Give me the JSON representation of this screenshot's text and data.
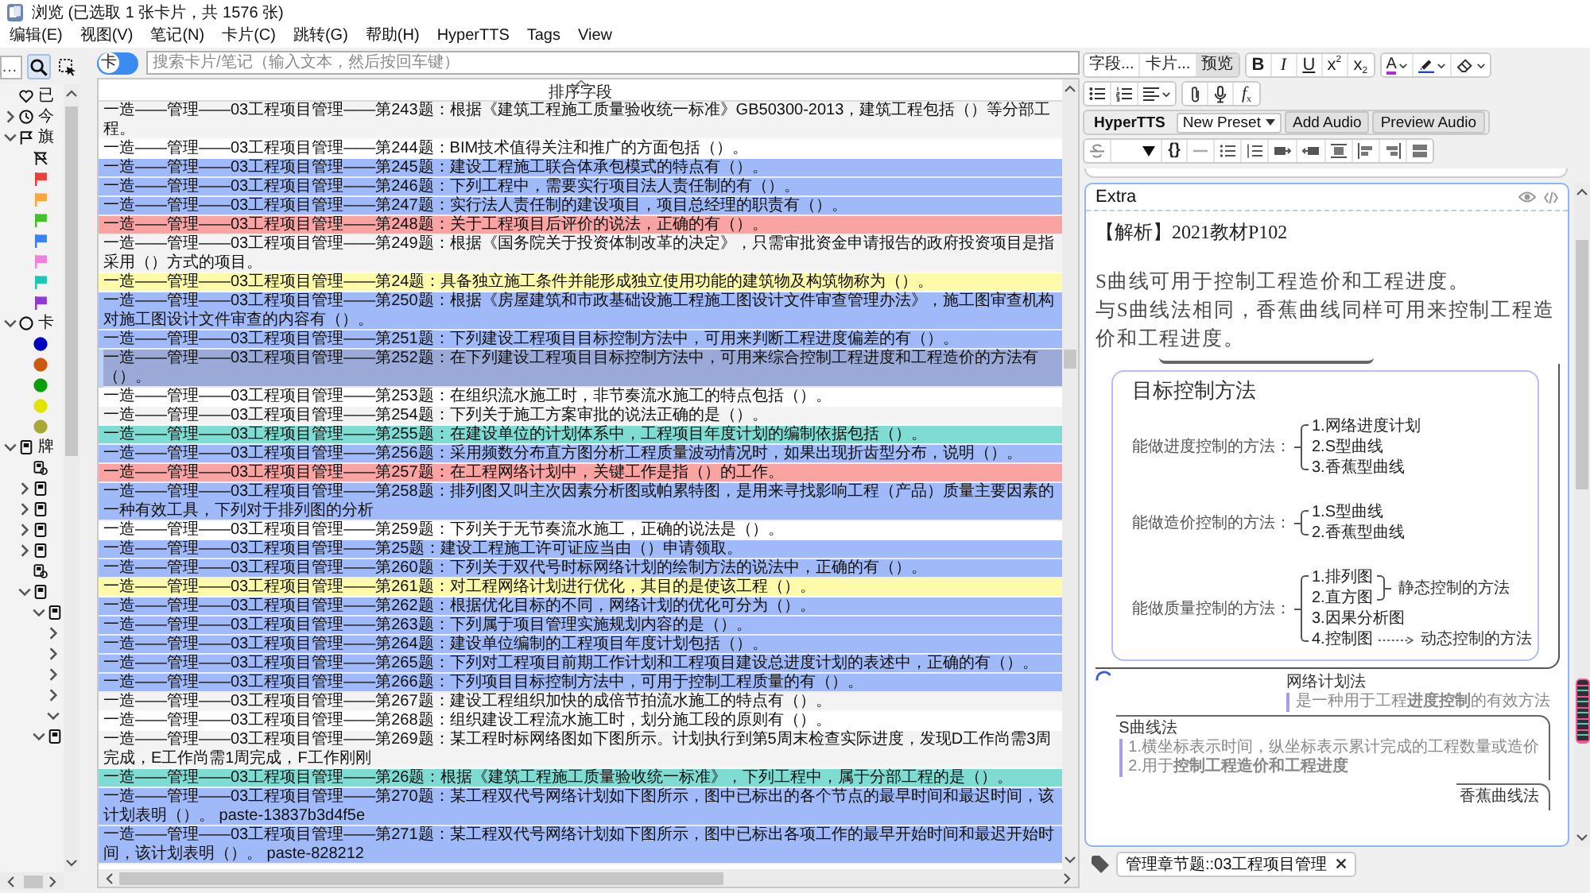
{
  "window": {
    "title": "浏览 (已选取 1 张卡片，共 1576 张)"
  },
  "menu": [
    "编辑(E)",
    "视图(V)",
    "笔记(N)",
    "卡片(C)",
    "跳转(G)",
    "帮助(H)",
    "HyperTTS",
    "Tags",
    "View"
  ],
  "sidebar": {
    "search": {
      "placeholder": "…"
    },
    "tools": [
      {
        "selected": true
      },
      {
        "selected": false
      }
    ],
    "items": [
      {
        "kind": "saved",
        "label": "已"
      },
      {
        "kind": "today",
        "label": "今",
        "expanded": false
      },
      {
        "kind": "flags",
        "label": "旗",
        "expanded": true,
        "children": [
          {
            "kind": "unflagged"
          },
          {
            "kind": "flag",
            "color": "#e8413c"
          },
          {
            "kind": "flag",
            "color": "#fba73c"
          },
          {
            "kind": "flag",
            "color": "#47c12b"
          },
          {
            "kind": "flag",
            "color": "#3b82f0"
          },
          {
            "kind": "flag",
            "color": "#f27fd9"
          },
          {
            "kind": "flag",
            "color": "#1cc6b3"
          },
          {
            "kind": "flag",
            "color": "#8f3bd6"
          }
        ]
      },
      {
        "kind": "states",
        "label": "卡",
        "expanded": true,
        "children": [
          {
            "kind": "state",
            "color": "#0000c0"
          },
          {
            "kind": "state",
            "color": "#cc5a12"
          },
          {
            "kind": "state",
            "color": "#0a9e0a"
          },
          {
            "kind": "state",
            "color": "#e3e300"
          },
          {
            "kind": "state",
            "color": "#a8a838"
          }
        ]
      },
      {
        "kind": "decks",
        "label": "牌",
        "expanded": true,
        "children": [
          {
            "kind": "filtered"
          },
          {
            "kind": "deck",
            "expanded": false
          },
          {
            "kind": "deck",
            "expanded": false
          },
          {
            "kind": "deck",
            "expanded": false
          },
          {
            "kind": "deck",
            "expanded": false
          },
          {
            "kind": "filtered"
          },
          {
            "kind": "deck",
            "expanded": true,
            "children": [
              {
                "kind": "deck",
                "expanded": true,
                "children": [
                  {
                    "expanded": false
                  },
                  {
                    "expanded": false
                  },
                  {
                    "expanded": false
                  },
                  {
                    "expanded": false
                  },
                  {
                    "expanded": true
                  }
                ]
              },
              {
                "kind": "deck",
                "expanded": true
              }
            ]
          }
        ]
      }
    ]
  },
  "mode_toggle": {
    "label": "卡",
    "on": false
  },
  "search": {
    "placeholder": "搜索卡片/笔记（输入文本，然后按回车键）"
  },
  "table": {
    "columns": [
      {
        "label": "排序字段",
        "sorted": true
      }
    ],
    "rows": [
      {
        "text": "一造——管理——03工程项目管理——第243题：根据《建筑工程施工质量验收统一标准》GB50300-2013，建筑工程包括（）等分部工程。",
        "selected": false
      },
      {
        "text": "一造——管理——03工程项目管理——第244题：BIM技术值得关注和推广的方面包括（）。",
        "selected": false
      },
      {
        "text": "一造——管理——03工程项目管理——第245题：建设工程施工联合体承包模式的特点有（）。",
        "selected": false,
        "color": "#a0b9f8"
      },
      {
        "text": "一造——管理——03工程项目管理——第246题：下列工程中，需要实行项目法人责任制的有（）。",
        "selected": false,
        "color": "#a0b9f8"
      },
      {
        "text": "一造——管理——03工程项目管理——第247题：实行法人责任制的建设项目，项目总经理的职责有（）。",
        "selected": false,
        "color": "#a0b9f8"
      },
      {
        "text": "一造——管理——03工程项目管理——第248题：关于工程项目后评价的说法，正确的有（）。",
        "selected": false,
        "color": "#f9a3a3"
      },
      {
        "text": "一造——管理——03工程项目管理——第249题：根据《国务院关于投资体制改革的决定》，只需审批资金申请报告的政府投资项目是指采用（）方式的项目。",
        "selected": false
      },
      {
        "text": "一造——管理——03工程项目管理——第24题：具备独立施工条件并能形成独立使用功能的建筑物及构筑物称为（）。",
        "selected": false,
        "color": "#fdfaa9"
      },
      {
        "text": "一造——管理——03工程项目管理——第250题：根据《房屋建筑和市政基础设施工程施工图设计文件审查管理办法》，施工图审查机构对施工图设计文件审查的内容有（）。",
        "selected": false,
        "color": "#a0b9f8"
      },
      {
        "text": "一造——管理——03工程项目管理——第251题：下列建设工程项目目标控制方法中，可用来判断工程进度偏差的有（）。",
        "selected": false,
        "color": "#a0b9f8"
      },
      {
        "text": "一造——管理——03工程项目管理——第252题：在下列建设工程项目目标控制方法中，可用来综合控制工程进度和工程造价的方法有（）。",
        "selected": true
      },
      {
        "text": "一造——管理——03工程项目管理——第253题：在组织流水施工时，非节奏流水施工的特点包括（）。",
        "selected": false
      },
      {
        "text": "一造——管理——03工程项目管理——第254题：下列关于施工方案审批的说法正确的是（）。",
        "selected": false
      },
      {
        "text": "一造——管理——03工程项目管理——第255题：在建设单位的计划体系中，工程项目年度计划的编制依据包括（）。",
        "selected": false,
        "color": "#7fdcd3"
      },
      {
        "text": "一造——管理——03工程项目管理——第256题：采用频数分布直方图分析工程质量波动情况时，如果出现折齿型分布，说明（）。",
        "selected": false,
        "color": "#a0b9f8"
      },
      {
        "text": "一造——管理——03工程项目管理——第257题：在工程网络计划中，关键工作是指（）的工作。",
        "selected": false,
        "color": "#f9a3a3"
      },
      {
        "text": "一造——管理——03工程项目管理——第258题：排列图又叫主次因素分析图或帕累特图，是用来寻找影响工程（产品）质量主要因素的一种有效工具，下列对于排列图的分析",
        "selected": false,
        "color": "#a0b9f8"
      },
      {
        "text": "一造——管理——03工程项目管理——第259题：下列关于无节奏流水施工，正确的说法是（）。",
        "selected": false
      },
      {
        "text": "一造——管理——03工程项目管理——第25题：建设工程施工许可证应当由（）申请领取。",
        "selected": false,
        "color": "#a0b9f8"
      },
      {
        "text": "一造——管理——03工程项目管理——第260题：下列关于双代号时标网络计划的绘制方法的说法中，正确的有（）。",
        "selected": false,
        "color": "#a0b9f8"
      },
      {
        "text": "一造——管理——03工程项目管理——第261题：对工程网络计划进行优化，其目的是使该工程（）。",
        "selected": false,
        "color": "#fdfaa9"
      },
      {
        "text": "一造——管理——03工程项目管理——第262题：根据优化目标的不同，网络计划的优化可分为（）。",
        "selected": false,
        "color": "#a0b9f8"
      },
      {
        "text": "一造——管理——03工程项目管理——第263题：下列属于项目管理实施规划内容的是（）。",
        "selected": false,
        "color": "#a0b9f8"
      },
      {
        "text": "一造——管理——03工程项目管理——第264题：建设单位编制的工程项目年度计划包括（）。",
        "selected": false,
        "color": "#a0b9f8"
      },
      {
        "text": "一造——管理——03工程项目管理——第265题：下列对工程项目前期工作计划和工程项目建设总进度计划的表述中，正确的有（）。",
        "selected": false,
        "color": "#a0b9f8"
      },
      {
        "text": "一造——管理——03工程项目管理——第266题：下列项目目标控制方法中，可用于控制工程质量的有（）。",
        "selected": false,
        "color": "#a0b9f8"
      },
      {
        "text": "一造——管理——03工程项目管理——第267题：建设工程组织加快的成倍节拍流水施工的特点有（）。",
        "selected": false
      },
      {
        "text": "一造——管理——03工程项目管理——第268题：组织建设工程流水施工时，划分施工段的原则有（）。",
        "selected": false
      },
      {
        "text": "一造——管理——03工程项目管理——第269题：某工程时标网络图如下图所示。计划执行到第5周末检查实际进度，发现D工作尚需3周完成，E工作尚需1周完成，F工作刚刚",
        "selected": false
      },
      {
        "text": "一造——管理——03工程项目管理——第26题：根据《建筑工程施工质量验收统一标准》，下列工程中，属于分部工程的是（）。",
        "selected": false,
        "color": "#7fdcd3"
      },
      {
        "text": "一造——管理——03工程项目管理——第270题：某工程双代号网络计划如下图所示，图中已标出的各个节点的最早时间和最迟时间，该计划表明（）。 paste-13837b3d4f5e",
        "selected": false,
        "color": "#a0b9f8"
      },
      {
        "text": "一造——管理——03工程项目管理——第271题：某工程双代号网络计划如下图所示，图中已标出各项工作的最早开始时间和最迟开始时间，该计划表明（）。 paste-828212",
        "selected": false,
        "color": "#a0b9f8"
      }
    ]
  },
  "editor": {
    "field_buttons": [
      {
        "label": "字段...",
        "pressed": false
      },
      {
        "label": "卡片...",
        "pressed": false
      },
      {
        "label": "预览",
        "pressed": true
      }
    ],
    "format_buttons": [
      {
        "kind": "bold",
        "label": "B"
      },
      {
        "kind": "italic",
        "label": "I"
      },
      {
        "kind": "underline",
        "label": "U"
      },
      {
        "kind": "superscript",
        "label": "x$^{2}$"
      },
      {
        "kind": "subscript",
        "label": "x$_{2}$"
      }
    ],
    "color_button": {
      "label": "A"
    },
    "math_button": {
      "label": "*f*$_{x}$"
    },
    "hypertts": {
      "title": "HyperTTS",
      "preset": "New Preset",
      "buttons": [
        "Add Audio",
        "Preview Audio"
      ]
    },
    "code_button": {
      "label": "{}"
    },
    "field": {
      "name": "Extra",
      "note": "【解析】2021教材P102",
      "paragraphs": [
        "S曲线可用于控制工程造价和工程进度。",
        "与S曲线法相同，香蕉曲线同样可用来控制工程造价和工程进度。"
      ],
      "image": {
        "title": "目标控制方法",
        "branches": [
          {
            "label": "能做进度控制的方法：",
            "items": [
              {
                "kind": "leaf",
                "text": "1.网络进度计划"
              },
              {
                "kind": "leaf",
                "text": "2.S型曲线"
              },
              {
                "kind": "leaf",
                "text": "3.香蕉型曲线"
              }
            ]
          },
          {
            "label": "能做造价控制的方法：",
            "items": [
              {
                "kind": "leaf",
                "text": "1.S型曲线"
              },
              {
                "kind": "leaf",
                "text": "2.香蕉型曲线"
              }
            ]
          },
          {
            "label": "能做质量控制的方法：",
            "items": [
              {
                "kind": "bracket",
                "items": [
                  {
                    "text": "1.排列图"
                  },
                  {
                    "text": "2.直方图"
                  }
                ],
                "note": "静态控制的方法"
              },
              {
                "kind": "leaf",
                "text": "3.因果分析图"
              },
              {
                "kind": "arrow",
                "text": "4.控制图",
                "note": "动态控制的方法"
              }
            ]
          }
        ],
        "nodes": [
          {
            "title": "网络计划法",
            "lines": [
              "是一种用于工程**进度控制**的有效方法"
            ]
          },
          {
            "title": "S曲线法",
            "lines": [
              "1.横坐标表示时间，纵坐标表示累计完成的工程数量或造价",
              "2.用于**控制工程造价和工程进度**"
            ]
          },
          {
            "title": "香蕉曲线法"
          }
        ]
      }
    },
    "tags": [
      "管理章节题::03工程项目管理"
    ]
  }
}
